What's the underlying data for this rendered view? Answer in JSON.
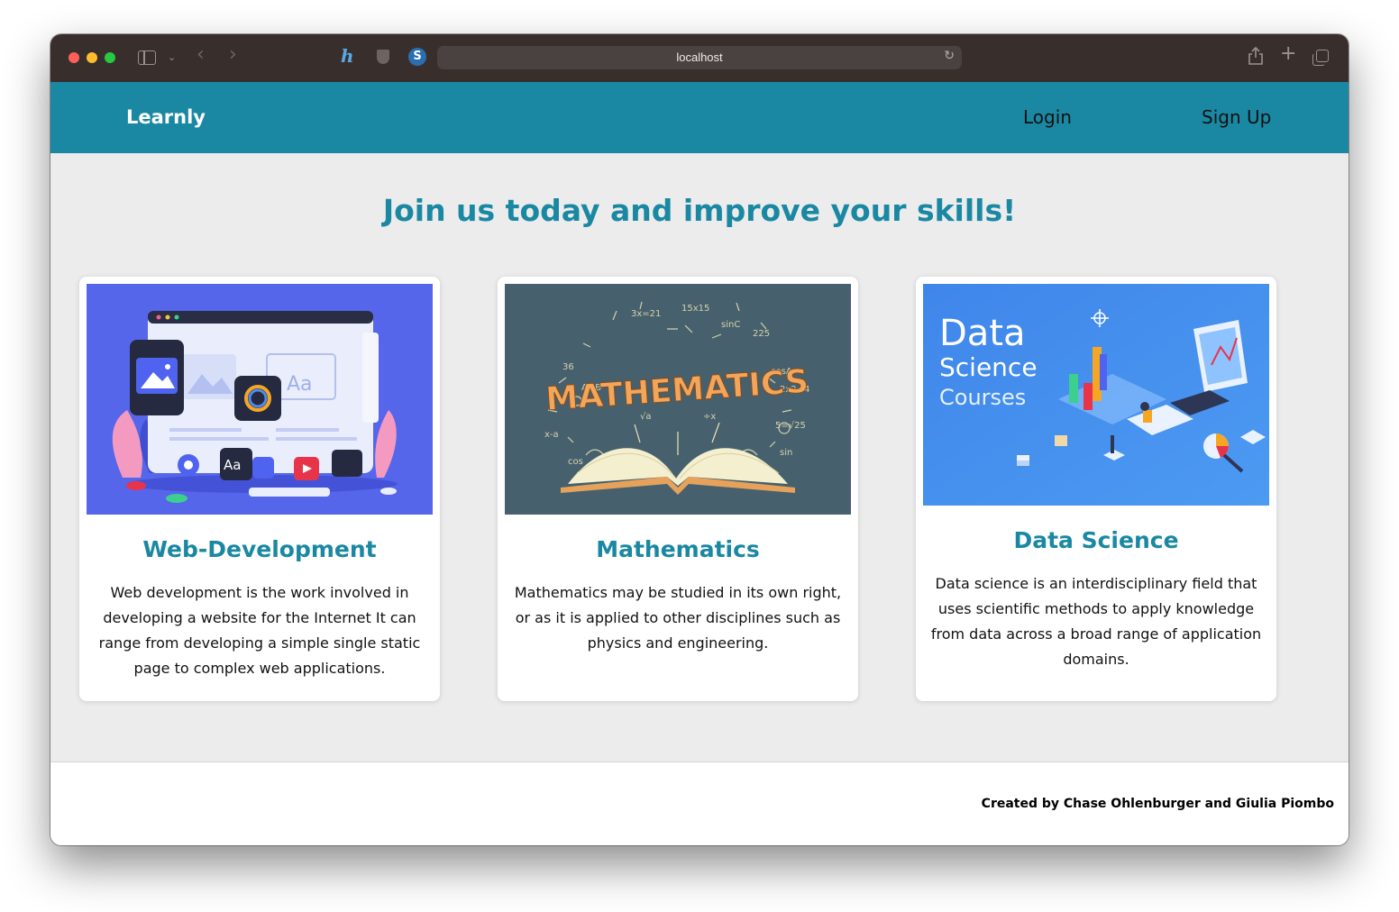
{
  "browser": {
    "url": "localhost",
    "icons": [
      "sidebar-icon",
      "chevron-down-icon",
      "back-icon",
      "forward-icon",
      "honey-extension-icon",
      "shield-extension-icon",
      "s-extension-icon",
      "reload-icon",
      "share-icon",
      "new-tab-icon",
      "tab-overview-icon"
    ]
  },
  "navbar": {
    "brand": "Learnly",
    "links": {
      "login": "Login",
      "signup": "Sign Up"
    },
    "background": "#1a88a2"
  },
  "hero": {
    "title": "Join us today and improve your skills!"
  },
  "cards": [
    {
      "title": "Web-Development",
      "text": "Web development is the work involved in developing a website for the Internet It can range from developing a simple single static page to complex web applications."
    },
    {
      "title": "Mathematics",
      "text": "Mathematics may be studied in its own right, or as it is applied to other disciplines such as physics and engineering.",
      "image_word": "MATHEMATICS"
    },
    {
      "title": "Data Science",
      "text": "Data science is an interdisciplinary field that uses scientific methods to apply knowledge from data across a broad range of application domains.",
      "image_lines": [
        "Data",
        "Science",
        "Courses"
      ]
    }
  ],
  "footer": {
    "credit": "Created by Chase Ohlenburger and Giulia Piombo"
  },
  "colors": {
    "accent": "#1a88a2",
    "page_bg": "#ececec",
    "card_bg": "#ffffff"
  }
}
